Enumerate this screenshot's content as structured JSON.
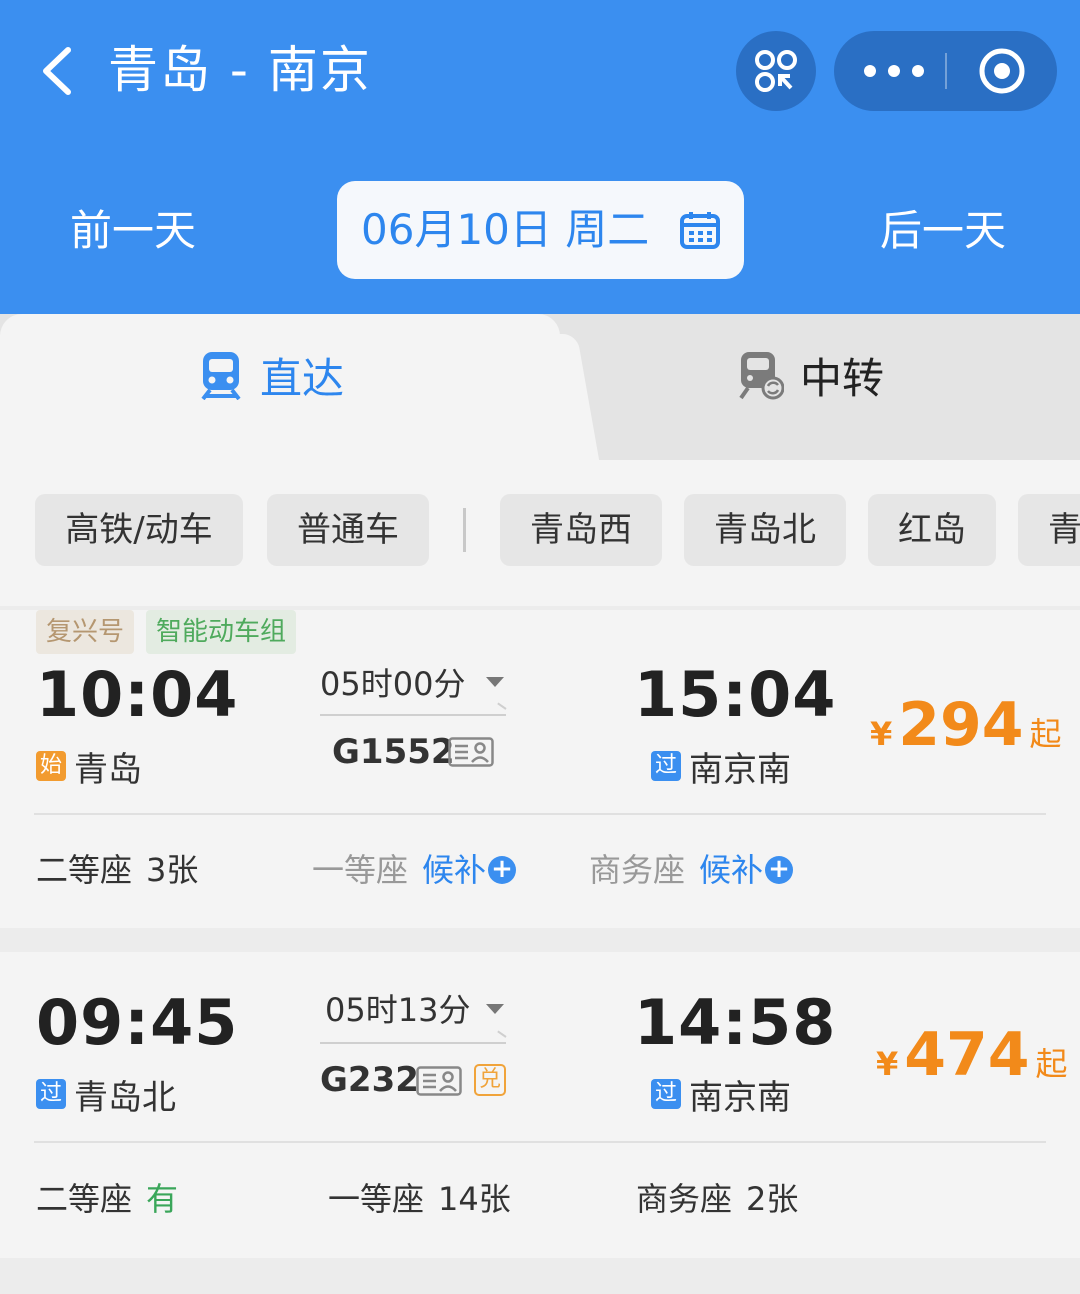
{
  "header": {
    "route_title": "青岛 - 南京",
    "prev_day": "前一天",
    "next_day": "后一天",
    "date": "06月10日 周二"
  },
  "tabs": [
    {
      "label": "直达",
      "active": true
    },
    {
      "label": "中转",
      "active": false
    }
  ],
  "filters": {
    "train_types": [
      "高铁/动车",
      "普通车"
    ],
    "stations": [
      "青岛西",
      "青岛北",
      "红岛",
      "青"
    ]
  },
  "trains": [
    {
      "tags": [
        "复兴号",
        "智能动车组"
      ],
      "dep_time": "10:04",
      "dep_badge": "始",
      "dep_station": "青岛",
      "duration": "05时00分",
      "train_no": "G1552",
      "arr_time": "15:04",
      "arr_badge": "过",
      "arr_station": "南京南",
      "price_symbol": "¥",
      "price": "294",
      "price_suffix": "起",
      "seats": [
        {
          "name": "二等座",
          "value": "3张"
        },
        {
          "name": "一等座",
          "value": "候补"
        },
        {
          "name": "商务座",
          "value": "候补"
        }
      ]
    },
    {
      "tags": [],
      "dep_time": "09:45",
      "dep_badge": "过",
      "dep_station": "青岛北",
      "duration": "05时13分",
      "train_no": "G232",
      "redeem_badge": "兑",
      "arr_time": "14:58",
      "arr_badge": "过",
      "arr_station": "南京南",
      "price_symbol": "¥",
      "price": "474",
      "price_suffix": "起",
      "seats": [
        {
          "name": "二等座",
          "value": "有"
        },
        {
          "name": "一等座",
          "value": "14张"
        },
        {
          "name": "商务座",
          "value": "2张"
        }
      ]
    }
  ],
  "colors": {
    "header_blue": "#3b8ff0",
    "accent_blue": "#2d86ee",
    "price_orange": "#f28a1a",
    "available_green": "#3aa65a"
  }
}
